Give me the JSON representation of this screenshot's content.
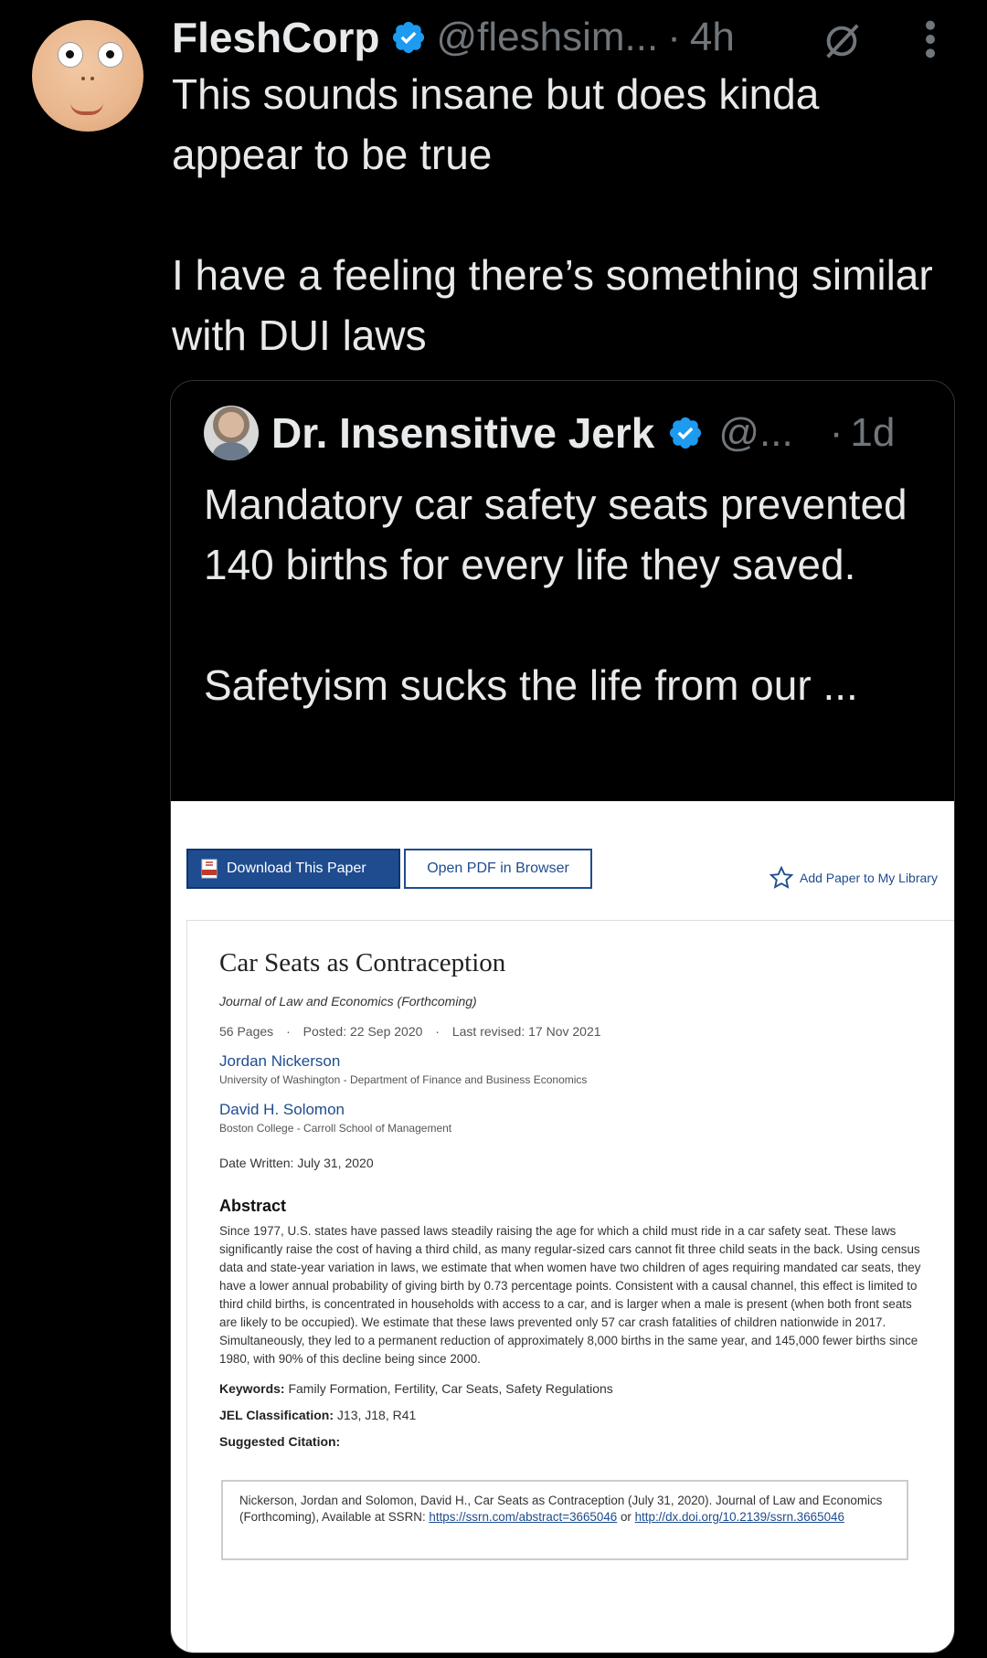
{
  "tweet": {
    "display_name": "FleshCorp",
    "handle": "@fleshsim...",
    "separator": "·",
    "time": "4h",
    "text_line1": "This sounds insane but does kinda appear to be true",
    "text_line2": "I have a feeling there’s something similar with DUI laws"
  },
  "quote": {
    "display_name": "Dr. Insensitive Jerk",
    "handle": "@...",
    "separator": "·",
    "time": "1d",
    "text_line1": "Mandatory car safety seats prevented 140 births for every life they saved.",
    "text_line2": "Safetyism sucks the life from our ..."
  },
  "paper": {
    "download_label": "Download This Paper",
    "open_pdf_label": "Open PDF in Browser",
    "add_library_label": "Add Paper to My Library",
    "title": "Car Seats as Contraception",
    "journal": "Journal of Law and Economics (Forthcoming)",
    "pages": "56 Pages",
    "posted": "Posted: 22 Sep 2020",
    "revised": "Last revised: 17 Nov 2021",
    "meta_sep": "·",
    "authors": [
      {
        "name": "Jordan Nickerson",
        "affiliation": "University of Washington - Department of Finance and Business Economics"
      },
      {
        "name": "David H. Solomon",
        "affiliation": "Boston College - Carroll School of Management"
      }
    ],
    "date_written": "Date Written: July 31, 2020",
    "abstract_title": "Abstract",
    "abstract": "Since 1977, U.S. states have passed laws steadily raising the age for which a child must ride in a car safety seat. These laws significantly raise the cost of having a third child, as many regular-sized cars cannot fit three child seats in the back. Using census data and state-year variation in laws, we estimate that when women have two children of ages requiring mandated car seats, they have a lower annual probability of giving birth by 0.73 percentage points. Consistent with a causal channel, this effect is limited to third child births, is concentrated in households with access to a car, and is larger when a male is present (when both front seats are likely to be occupied). We estimate that these laws prevented only 57 car crash fatalities of children nationwide in 2017. Simultaneously, they led to a permanent reduction of approximately 8,000 births in the same year, and 145,000 fewer births since 1980, with 90% of this decline being since 2000.",
    "keywords_label": "Keywords:",
    "keywords": "Family Formation, Fertility, Car Seats, Safety Regulations",
    "jel_label": "JEL Classification:",
    "jel": "J13, J18, R41",
    "citation_label": "Suggested Citation:",
    "citation_text": "Nickerson, Jordan and Solomon, David H., Car Seats as Contraception (July 31, 2020). Journal of Law and Economics (Forthcoming), Available at SSRN:",
    "citation_link1": "https://ssrn.com/abstract=3665046",
    "citation_or": "or",
    "citation_link2": "http://dx.doi.org/10.2139/ssrn.3665046"
  },
  "colors": {
    "background": "#000000",
    "text": "#e7e9ea",
    "muted": "#71767b",
    "verified": "#1d9bf0",
    "ssrn_blue": "#1e4c8f"
  },
  "icons": {
    "verified": "verified-badge-icon",
    "grok": "grok-icon",
    "more": "more-vertical-icon",
    "pdf": "pdf-icon",
    "star": "star-outline-icon"
  }
}
